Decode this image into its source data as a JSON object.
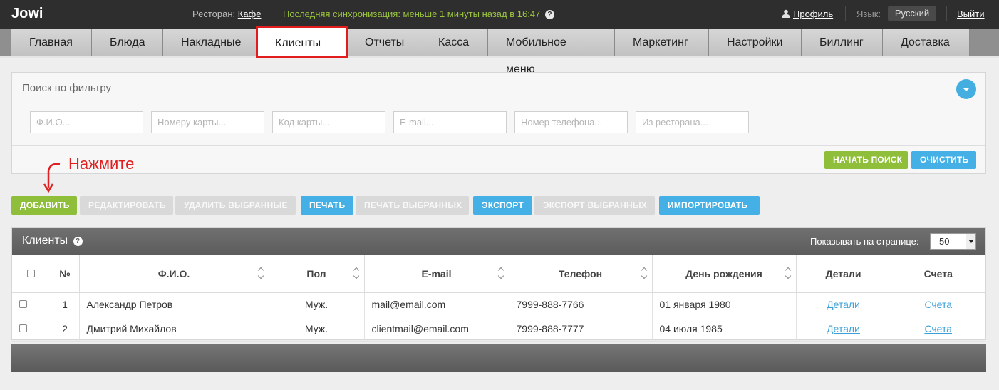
{
  "topbar": {
    "logo": "Jowi",
    "restaurant_label": "Ресторан:",
    "restaurant_name": "Кафе",
    "sync_text": "Последняя синхронизация: меньше 1 минуты назад в 16:47",
    "sync_help": "?",
    "profile": "Профиль",
    "lang_label": "Язык:",
    "lang_value": "Русский",
    "logout": "Выйти"
  },
  "nav": {
    "items": [
      "Главная",
      "Блюда",
      "Накладные",
      "Клиенты",
      "Отчеты",
      "Касса",
      "Мобильное меню",
      "Маркетинг",
      "Настройки",
      "Биллинг",
      "Доставка"
    ],
    "active": "Клиенты"
  },
  "filter": {
    "title": "Поиск по фильтру",
    "placeholders": [
      "Ф.И.О...",
      "Номеру карты...",
      "Код карты...",
      "E-mail...",
      "Номер телефона...",
      "Из ресторана..."
    ],
    "search_button": "Начать поиск",
    "clear_button": "Очистить"
  },
  "annotation": {
    "text": "Нажмите"
  },
  "toolbar": {
    "add": "Добавить",
    "edit": "Редактировать",
    "delete_selected": "Удалить выбранные",
    "print": "Печать",
    "print_selected": "Печать выбранных",
    "export": "Экспорт",
    "export_selected": "Экспорт выбранных",
    "import": "Импортировать"
  },
  "table": {
    "title": "Клиенты",
    "title_help": "?",
    "per_page_label": "Показывать на странице:",
    "per_page_value": "50",
    "columns": [
      "№",
      "Ф.И.О.",
      "Пол",
      "E-mail",
      "Телефон",
      "День рождения",
      "Детали",
      "Счета"
    ],
    "rows": [
      {
        "num": "1",
        "name": "Александр Петров",
        "gender": "Муж.",
        "email": "mail@email.com",
        "phone": "7999-888-7766",
        "birthday": "01 января 1980",
        "details": "Детали",
        "accounts": "Счета"
      },
      {
        "num": "2",
        "name": "Дмитрий Михайлов",
        "gender": "Муж.",
        "email": "clientmail@email.com",
        "phone": "7999-888-7777",
        "birthday": "04 июля 1985",
        "details": "Детали",
        "accounts": "Счета"
      }
    ]
  },
  "colors": {
    "accent_blue": "#44b0e5",
    "accent_green": "#8fbf3a",
    "highlight_red": "#e21c1c"
  }
}
